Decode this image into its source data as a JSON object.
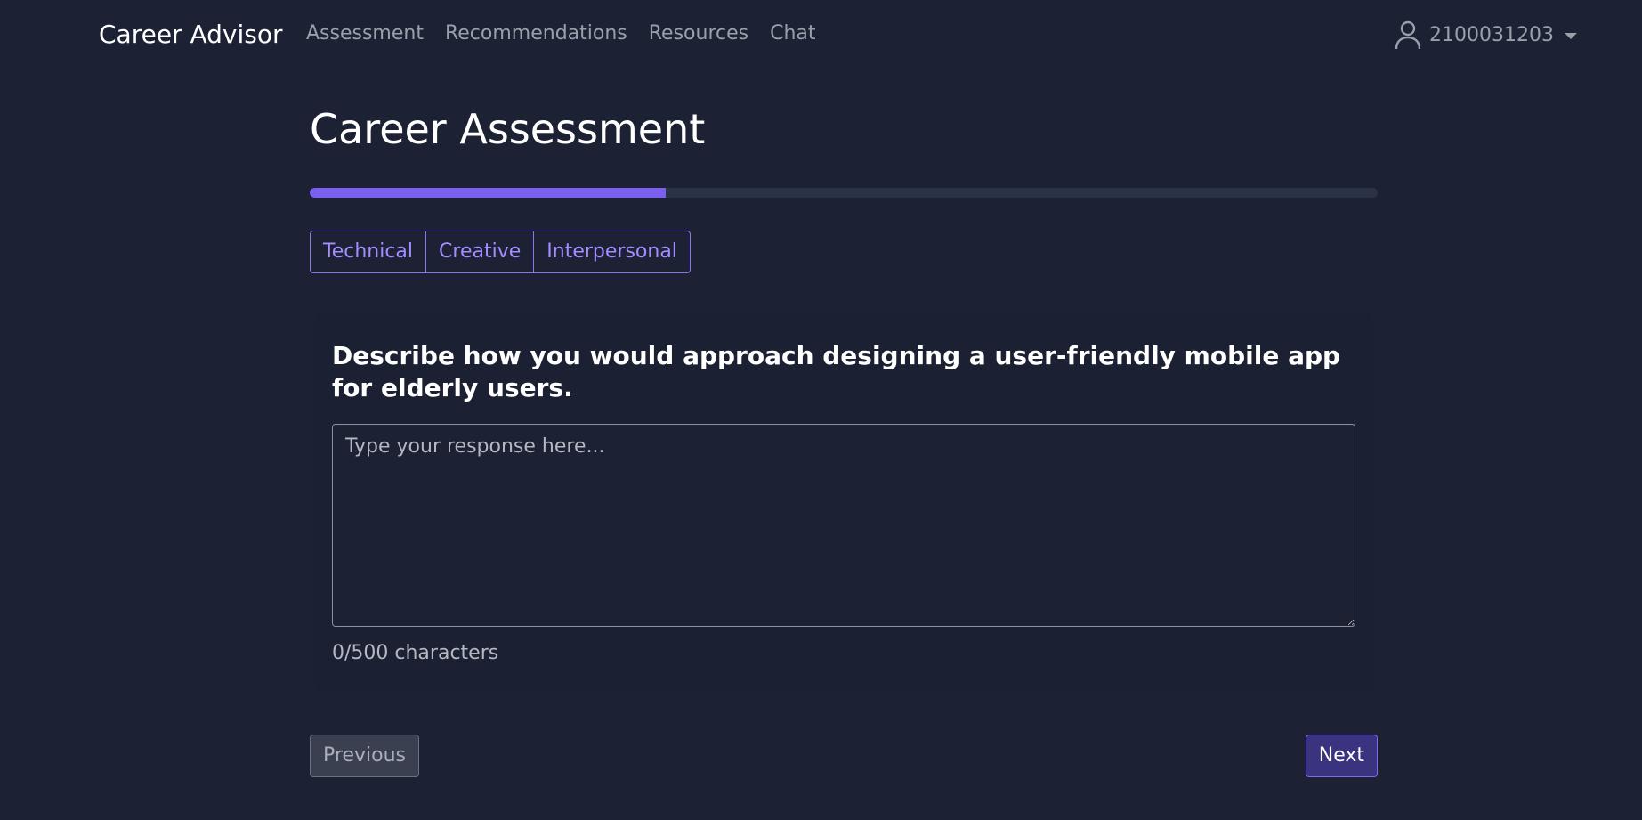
{
  "navbar": {
    "brand": "Career Advisor",
    "links": [
      "Assessment",
      "Recommendations",
      "Resources",
      "Chat"
    ],
    "user": {
      "icon": "user-icon",
      "name": "2100031203",
      "dropdown_icon": "caret-down-icon"
    }
  },
  "page": {
    "title": "Career Assessment",
    "progress_fraction": 0.333
  },
  "categories": [
    "Technical",
    "Creative",
    "Interpersonal"
  ],
  "question": {
    "text": "Describe how you would approach designing a user-friendly mobile app for elderly users.",
    "response_value": "",
    "response_placeholder": "Type your response here...",
    "char_count": "0/500 characters"
  },
  "buttons": {
    "previous": "Previous",
    "next": "Next"
  },
  "colors": {
    "background": "#1c2233",
    "accent": "#7a5ff0",
    "accent_text": "#a48dff",
    "progress_track": "#2a3245",
    "next_button": "#3a3380",
    "previous_button": "#3a4050"
  }
}
